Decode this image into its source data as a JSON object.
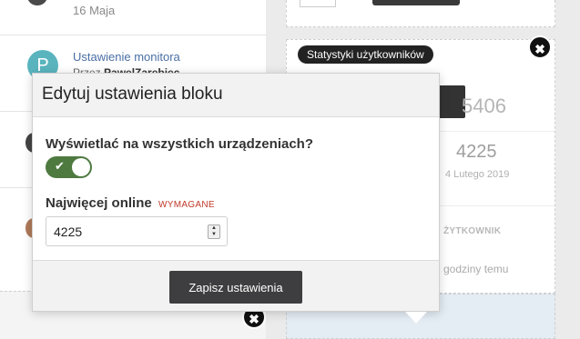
{
  "activity": {
    "date_label": "16 Maja",
    "avatar_letter": "P",
    "item_title": "Ustawienie monitora",
    "item_by_prefix": "Przez ",
    "item_by_user": "PawelZarebiec"
  },
  "stats_widget": {
    "header": "Statystyki użytkowników",
    "total_value": "5406",
    "online_max": "4225",
    "online_date": "4 Lutego 2019",
    "user_label": "ŻYTKOWNIK",
    "time_ago": "godziny temu"
  },
  "modal": {
    "title": "Edytuj ustawienia bloku",
    "show_all_devices_label": "Wyświetlać na wszystkich urządzeniach?",
    "show_all_devices_value": true,
    "max_online_label": "Najwięcej online",
    "required_tag": "WYMAGANE",
    "max_online_value": "4225",
    "save_label": "Zapisz ustawienia"
  },
  "icons": {
    "close": "close-icon",
    "check": "check-icon",
    "spinner_up": "chevron-up-icon",
    "spinner_down": "chevron-down-icon"
  },
  "colors": {
    "toggle_on": "#4e7a40",
    "required": "#c0392b",
    "save_button": "#3e3e40",
    "avatar": "#5ab4be",
    "link": "#4a6fa5"
  }
}
